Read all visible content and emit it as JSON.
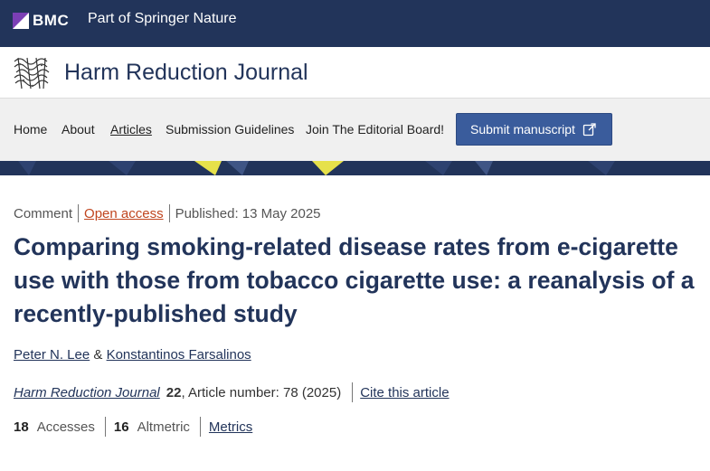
{
  "header": {
    "brand": "BMC",
    "tagline": "Part of Springer Nature",
    "brand_color": "#22345a",
    "accent_color": "#7b3fb5"
  },
  "journal": {
    "title": "Harm Reduction Journal",
    "logo_icon": "journal-wave-logo"
  },
  "nav": {
    "items": [
      {
        "label": "Home",
        "active": false
      },
      {
        "label": "About",
        "active": false
      },
      {
        "label": "Articles",
        "active": true
      },
      {
        "label": "Submission Guidelines",
        "active": false
      },
      {
        "label": "Join The Editorial Board!",
        "active": false
      }
    ],
    "submit_label": "Submit manuscript",
    "submit_icon": "external-link-icon",
    "submit_color": "#3a5c9c"
  },
  "article": {
    "type": "Comment",
    "access": "Open access",
    "published": "Published: 13 May 2025",
    "title": "Comparing smoking-related disease rates from e-cigarette use with those from tobacco cigarette use: a reanalysis of a recently-published study",
    "authors": [
      "Peter N. Lee",
      "Konstantinos Farsalinos"
    ],
    "author_joiner": "&",
    "citation": {
      "journal": "Harm Reduction Journal",
      "volume": "22",
      "details": ", Article number: 78 (2025)",
      "cite_label": "Cite this article"
    },
    "metrics": {
      "accesses_count": "18",
      "accesses_label": "Accesses",
      "altmetric_count": "16",
      "altmetric_label": "Altmetric",
      "metrics_label": "Metrics"
    }
  }
}
